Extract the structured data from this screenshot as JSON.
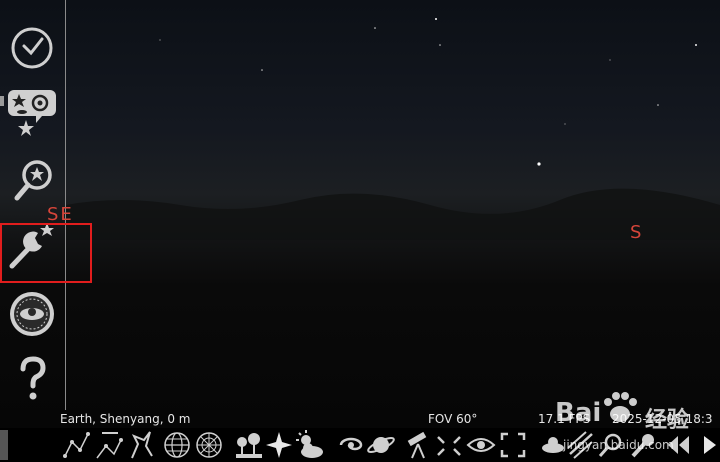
{
  "sidebar": {
    "items": [
      {
        "name": "date-time-window",
        "icon": "clock-icon"
      },
      {
        "name": "sky-viewing-options",
        "icon": "galaxy-settings-icon"
      },
      {
        "name": "search-window",
        "icon": "search-star-icon"
      },
      {
        "name": "configuration-window",
        "icon": "wrench-star-icon"
      },
      {
        "name": "observatory-window",
        "icon": "compass-dial-icon"
      },
      {
        "name": "help-window",
        "icon": "question-icon"
      }
    ]
  },
  "sky": {
    "cardinals": {
      "southeast": "SE",
      "south": "S"
    }
  },
  "status": {
    "location": "Earth, Shenyang, 0 m",
    "fov": "FOV 60°",
    "fps": "17.1 FPS",
    "datetime": "2025-12-05 18:3"
  },
  "bottom_toolbar": {
    "buttons": [
      {
        "name": "constellation-lines-button",
        "icon": "constellation-lines-icon"
      },
      {
        "name": "constellation-labels-button",
        "icon": "constellation-labels-icon"
      },
      {
        "name": "constellation-art-button",
        "icon": "constellation-art-icon"
      },
      {
        "name": "equatorial-grid-button",
        "icon": "equatorial-grid-icon"
      },
      {
        "name": "azimuthal-grid-button",
        "icon": "azimuthal-grid-icon"
      },
      {
        "name": "ground-button",
        "icon": "ground-trees-icon"
      },
      {
        "name": "cardinal-points-button",
        "icon": "compass-star-icon"
      },
      {
        "name": "atmosphere-button",
        "icon": "cloud-sun-icon"
      },
      {
        "name": "deep-sky-objects-button",
        "icon": "galaxy-icon"
      },
      {
        "name": "planet-labels-button",
        "icon": "planet-icon"
      },
      {
        "name": "equatorial-mount-button",
        "icon": "telescope-icon"
      },
      {
        "name": "center-on-selected-button",
        "icon": "center-arrows-icon"
      },
      {
        "name": "night-mode-button",
        "icon": "eye-icon"
      },
      {
        "name": "fullscreen-button",
        "icon": "fullscreen-icon"
      },
      {
        "name": "satellites-button",
        "icon": "satellite-icon"
      },
      {
        "name": "meteor-showers-button",
        "icon": "meteor-icon"
      },
      {
        "name": "search-extra-button",
        "icon": "search-icon"
      },
      {
        "name": "tool-button",
        "icon": "wrench-icon"
      },
      {
        "name": "decrease-time-speed-button",
        "icon": "rewind-icon"
      },
      {
        "name": "play-button",
        "icon": "play-icon"
      }
    ]
  },
  "watermark": {
    "brand": "Bai",
    "chinese": "经验",
    "url": "jingyan.baidu.com"
  },
  "colors": {
    "highlight": "#e11d1d",
    "cardinal": "#d6453a",
    "icon": "#d0d0d0"
  }
}
